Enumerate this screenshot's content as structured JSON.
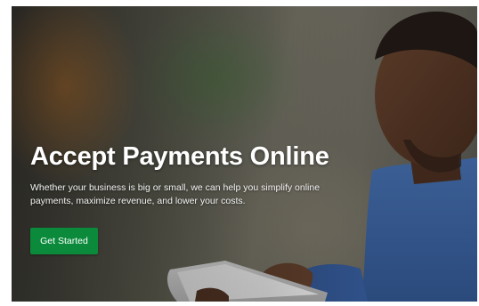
{
  "hero": {
    "title": "Accept Payments Online",
    "subtitle": "Whether your business is big or small, we can help you simplify online payments, maximize revenue, and lower your costs.",
    "cta_label": "Get Started",
    "cta_color": "#0c8a3c",
    "image_subject": "man-using-tablet"
  }
}
